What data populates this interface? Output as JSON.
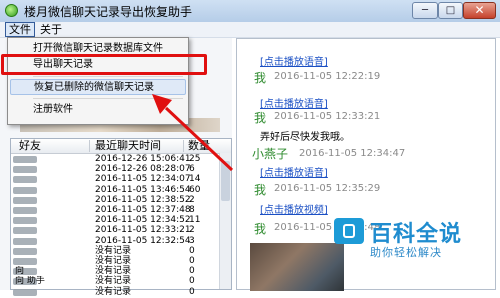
{
  "window": {
    "title": "楼月微信聊天记录导出恢复助手",
    "min_glyph": "─",
    "max_glyph": "□",
    "close_glyph": "✕"
  },
  "menubar": {
    "file": "文件",
    "about": "关于"
  },
  "dropdown": {
    "items": [
      "打开微信聊天记录数据库文件",
      "导出聊天记录",
      "恢复已删除的微信聊天记录",
      "注册软件"
    ]
  },
  "table": {
    "headers": {
      "friend": "好友",
      "time": "最近聊天时间",
      "count": "数量"
    },
    "rows": [
      {
        "name": "",
        "time": "2016-12-26 15:06:41",
        "count": "25"
      },
      {
        "name": "",
        "time": "2016-12-26 08:28:07",
        "count": "6"
      },
      {
        "name": "",
        "time": "2016-11-05 12:34:07",
        "count": "14"
      },
      {
        "name": "",
        "time": "2016-11-05 13:46:54",
        "count": "60"
      },
      {
        "name": "",
        "time": "2016-11-05 12:38:52",
        "count": "2"
      },
      {
        "name": "",
        "time": "2016-11-05 12:37:48",
        "count": "8"
      },
      {
        "name": "",
        "time": "2016-11-05 12:34:52",
        "count": "11"
      },
      {
        "name": "",
        "time": "2016-11-05 12:33:21",
        "count": "2"
      },
      {
        "name": "",
        "time": "2016-11-05 12:32:54",
        "count": "3"
      },
      {
        "name": "",
        "time": "没有记录",
        "count": "0"
      },
      {
        "name": "",
        "time": "没有记录",
        "count": "0"
      },
      {
        "name": "向",
        "time": "没有记录",
        "count": "0"
      },
      {
        "name": "向   助手",
        "time": "没有记录",
        "count": "0"
      },
      {
        "name": "",
        "time": "没有记录",
        "count": "0"
      }
    ]
  },
  "chat": {
    "link_voice": "[点击播放语音]",
    "link_video": "[点击播放视频]",
    "me": "我",
    "friend": "小燕子",
    "msgs": {
      "m1_time": "2016-11-05 12:22:19",
      "m2_time": "2016-11-05 12:33:21",
      "m2_text": "弄好后尽快发我哦。",
      "m3_time": "2016-11-05 12:34:47",
      "m4_time": "2016-11-05 12:35:29",
      "m5_time": "2016-11-05 12:37:48"
    }
  },
  "watermark": {
    "title": "百科全说",
    "subtitle": "助你轻松解决"
  },
  "colors": {
    "highlight_red": "#e01010",
    "link_blue": "#1a4fc4",
    "sender_green": "#2e8b2e"
  }
}
